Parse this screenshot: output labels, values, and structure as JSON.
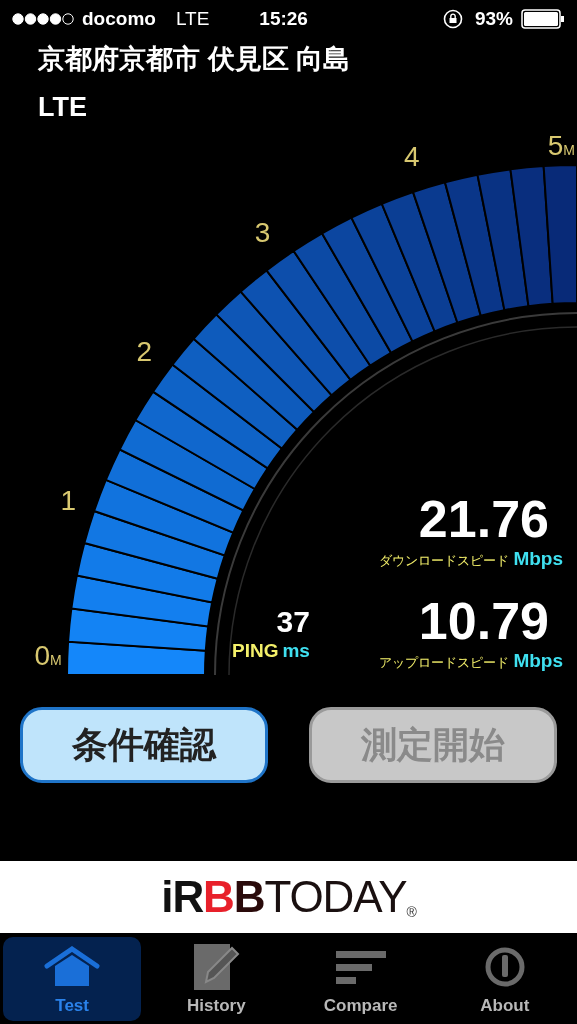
{
  "status_bar": {
    "carrier": "docomo",
    "network": "LTE",
    "time": "15:26",
    "battery": "93%"
  },
  "location": "京都府京都市 伏見区 向島",
  "connection": "LTE",
  "gauge": {
    "scale_labels": [
      {
        "value": "0",
        "unit": "M"
      },
      {
        "value": "1"
      },
      {
        "value": "2"
      },
      {
        "value": "3"
      },
      {
        "value": "4"
      },
      {
        "value": "5",
        "unit": "M"
      }
    ]
  },
  "download": {
    "value": "21.76",
    "label": "ダウンロードスピード",
    "unit": "Mbps"
  },
  "upload": {
    "value": "10.79",
    "label": "アップロードスピード",
    "unit": "Mbps"
  },
  "ping": {
    "value": "37",
    "label": "PING",
    "unit": "ms"
  },
  "buttons": [
    {
      "label": "条件確認",
      "disabled": false
    },
    {
      "label": "測定開始",
      "disabled": true
    }
  ],
  "banner": {
    "logo_parts": [
      "iR",
      "B",
      "B",
      "TODAY"
    ],
    "mark": "®"
  },
  "tabs": [
    {
      "label": "Test",
      "kind": "home",
      "selected": true
    },
    {
      "label": "History",
      "kind": "history",
      "selected": false
    },
    {
      "label": "Compare",
      "kind": "compare",
      "selected": false
    },
    {
      "label": "About",
      "kind": "about",
      "selected": false
    }
  ]
}
